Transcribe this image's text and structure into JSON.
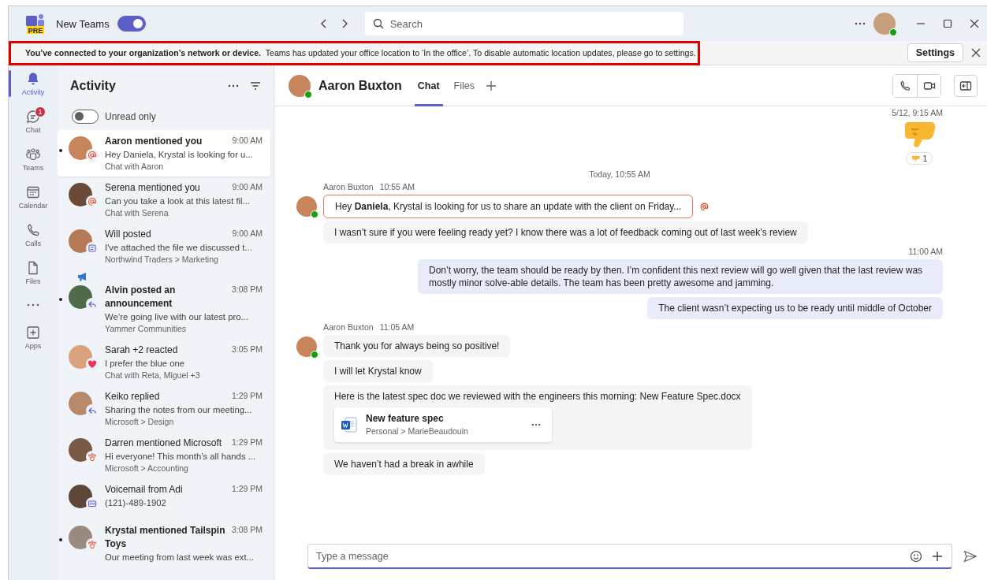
{
  "title_bar": {
    "app_name": "New Teams",
    "logo_badge": "PRE",
    "toggle_on": true,
    "search_placeholder": "Search"
  },
  "banner": {
    "bold_text": "You’ve connected to your organization’s network or device.",
    "text": "Teams has updated your office location to ‘In the office’.  To disable automatic location updates, please go to settings.",
    "highlighted": true,
    "button": "Settings"
  },
  "rail": [
    {
      "kind": "activity",
      "label": "Activity",
      "selected": true
    },
    {
      "kind": "chat",
      "label": "Chat",
      "selected": false,
      "badge": "1"
    },
    {
      "kind": "teams",
      "label": "Teams",
      "selected": false
    },
    {
      "kind": "calendar",
      "label": "Calendar",
      "selected": false
    },
    {
      "kind": "calls",
      "label": "Calls",
      "selected": false
    },
    {
      "kind": "files",
      "label": "Files",
      "selected": false
    },
    {
      "kind": "more",
      "selected": false
    },
    {
      "kind": "apps",
      "label": "Apps",
      "selected": false
    }
  ],
  "activity": {
    "title": "Activity",
    "filter": {
      "label": "Unread only",
      "on": false
    },
    "items": [
      {
        "kind": "mention",
        "title": "Aaron mentioned you",
        "time": "9:00 AM",
        "preview": "Hey Daniela, Krystal is looking for u...",
        "context": "Chat with Aaron",
        "unread": true,
        "selected": true,
        "source_icon": false
      },
      {
        "kind": "mention",
        "title": "Serena mentioned you",
        "time": "9:00 AM",
        "preview": "Can you take a look at this latest fil...",
        "context": "Chat with Serena",
        "unread": false,
        "selected": false,
        "source_icon": false
      },
      {
        "kind": "post",
        "title": "Will posted",
        "time": "9:00 AM",
        "preview": "I've attached the file we discussed t...",
        "context": "Northwind Traders > Marketing",
        "unread": false,
        "selected": false,
        "source_icon": false
      },
      {
        "kind": "reply",
        "title": "Alvin posted an announcement",
        "time": "3:08 PM",
        "preview": "We’re going live with our latest pro...",
        "context": "Yammer Communities",
        "unread": true,
        "selected": false,
        "source_icon": true
      },
      {
        "kind": "heart",
        "title": "Sarah +2 reacted",
        "time": "3:05 PM",
        "preview": "I prefer the blue one",
        "context": "Chat with Reta, Miguel +3",
        "unread": false,
        "selected": false,
        "source_icon": false
      },
      {
        "kind": "reply",
        "title": "Keiko replied",
        "time": "1:29 PM",
        "preview": "Sharing the notes from our meeting...",
        "context": "Microsoft > Design",
        "unread": false,
        "selected": false,
        "source_icon": false
      },
      {
        "kind": "team",
        "title": "Darren mentioned Microsoft",
        "time": "1:29 PM",
        "preview": "Hi everyone! This month’s all hands ...",
        "context": "Microsoft > Accounting",
        "unread": false,
        "selected": false,
        "source_icon": false
      },
      {
        "kind": "voicemail",
        "title": "Voicemail from Adi",
        "time": "1:29 PM",
        "preview": "(121)-489-1902",
        "unread": false,
        "selected": false,
        "source_icon": false
      },
      {
        "kind": "team",
        "title": "Krystal mentioned Tailspin Toys",
        "time": "3:08 PM",
        "preview": "Our meeting from last week was ext...",
        "unread": true,
        "selected": false,
        "source_icon": false
      }
    ]
  },
  "chat": {
    "name": "Aaron Buxton",
    "tabs": [
      {
        "label": "Chat",
        "selected": true
      },
      {
        "label": "Files",
        "selected": false
      }
    ],
    "items": [
      {
        "kind": "timestamp",
        "text": "5/12, 9:15 AM"
      },
      {
        "kind": "sticker",
        "count": "1"
      },
      {
        "kind": "divider",
        "text": "Today, 10:55 AM"
      },
      {
        "kind": "incoming",
        "sender": "Aaron Buxton",
        "time": "10:55 AM",
        "messages": [
          {
            "text": "Hey **Daniela**, Krystal is looking for us to share an update with the client on Friday...",
            "mention": true
          },
          {
            "text": "I wasn’t sure if you were feeling ready yet? I know there was a lot of feedback coming out of last week’s review",
            "mention": false
          }
        ]
      },
      {
        "kind": "timestamp",
        "text": "11:00 AM"
      },
      {
        "kind": "outgoing",
        "messages": [
          {
            "text": "Don’t worry, the team should be ready by then. I’m confident this next review will go well given that the last review was mostly minor solve-able details. The team has been pretty awesome and jamming."
          },
          {
            "text": "The client wasn’t expecting us to be ready until middle of October"
          }
        ]
      },
      {
        "kind": "incoming",
        "sender": "Aaron Buxton",
        "time": "11:05 AM",
        "messages": [
          {
            "text": "Thank you for always being so positive!",
            "mention": false
          },
          {
            "text": "I will let Krystal know",
            "mention": false
          },
          {
            "text": "Here is the latest spec doc we reviewed with the engineers this morning: New Feature Spec.docx",
            "mention": false,
            "attachment": {
              "name": "New feature spec",
              "path": "Personal > MarieBeaudouin"
            }
          },
          {
            "text": "We haven’t had a break in awhile",
            "mention": false
          }
        ]
      }
    ],
    "compose_placeholder": "Type a message"
  }
}
